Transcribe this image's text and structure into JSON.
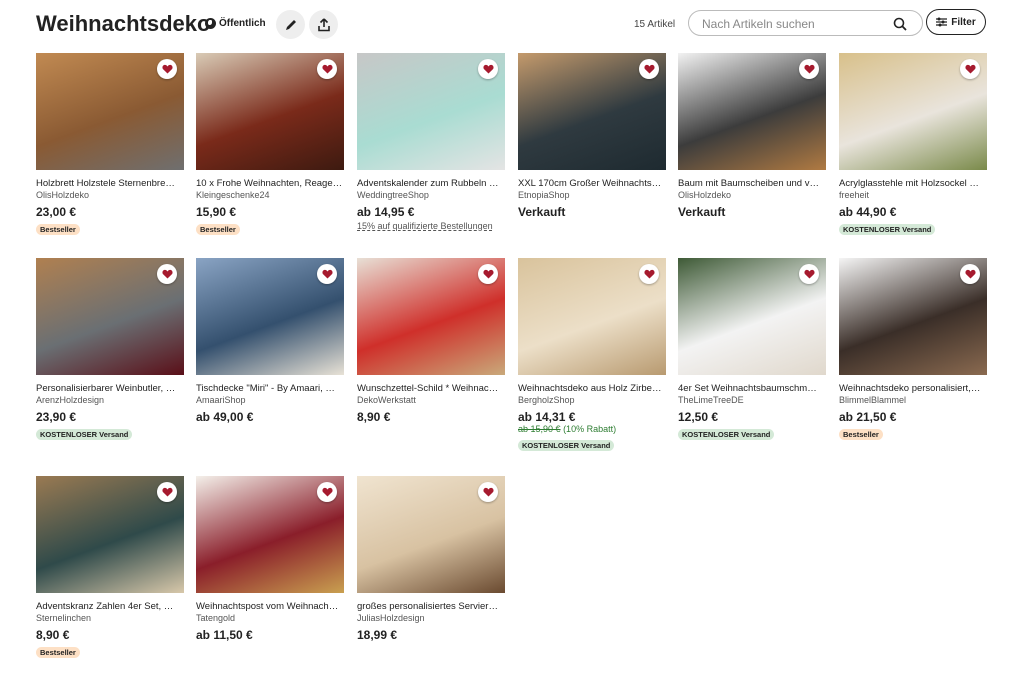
{
  "header": {
    "title": "Weihnachtsdeko",
    "visibility": "Öffentlich",
    "count": "15 Artikel",
    "search_placeholder": "Nach Artikeln suchen",
    "filter_label": "Filter",
    "icons": {
      "visibility": "globe-icon",
      "edit": "pencil-icon",
      "share": "share-icon",
      "search": "search-icon",
      "filter": "sliders-icon",
      "favorite": "heart-icon"
    }
  },
  "colors": {
    "accent": "#222222",
    "heart": "#a61a2e",
    "bestseller_badge": "#fde0c5",
    "shipping_badge": "#d4e9d7",
    "discount": "#2e7d32"
  },
  "items": [
    {
      "name": "Holzbrett Holzstele Sternenbre…",
      "shop": "OlisHolzdeko",
      "price": "23,00 €",
      "badge": "Bestseller",
      "badge_type": "best",
      "img": [
        "#8a5a33",
        "#c18a52",
        "#6f6f6f"
      ]
    },
    {
      "name": "10 x Frohe Weihnachten, Reage…",
      "shop": "Kleingeschenke24",
      "price": "15,90 €",
      "badge": "Bestseller",
      "badge_type": "best",
      "img": [
        "#7a2a1a",
        "#d9cbb6",
        "#3d1a10"
      ]
    },
    {
      "name": "Adventskalender zum Rubbeln …",
      "shop": "WeddingtreeShop",
      "price": "ab 14,95 €",
      "promo": "15% auf qualifizierte Bestellungen",
      "img": [
        "#a9dcd2",
        "#c7c7c7",
        "#e4e4e4"
      ]
    },
    {
      "name": "XXL 170cm Großer Weihnachts…",
      "shop": "EtnopiaShop",
      "price": "Verkauft",
      "img": [
        "#2f3a40",
        "#c49a6c",
        "#1e2a30"
      ]
    },
    {
      "name": "Baum mit Baumscheiben und v…",
      "shop": "OlisHolzdeko",
      "price": "Verkauft",
      "img": [
        "#3c3c3c",
        "#f2f2f2",
        "#b07a42"
      ]
    },
    {
      "name": "Acrylglasstehle mit Holzsockel …",
      "shop": "freeheit",
      "price": "ab 44,90 €",
      "badge": "KOSTENLOSER Versand",
      "badge_type": "free",
      "img": [
        "#e9e4dc",
        "#d8c08a",
        "#7a8a4a"
      ]
    },
    {
      "name": "Personalisierbarer Weinbutler, …",
      "shop": "ArenzHolzdesign",
      "price": "23,90 €",
      "badge": "KOSTENLOSER Versand",
      "badge_type": "free",
      "img": [
        "#6a6f73",
        "#b08050",
        "#5a0f18"
      ]
    },
    {
      "name": "Tischdecke \"Miri\" - By Amaari, …",
      "shop": "AmaariShop",
      "price": "ab 49,00 €",
      "img": [
        "#34506e",
        "#8aa4c4",
        "#e8e2d6"
      ]
    },
    {
      "name": "Wunschzettel-Schild * Weihnac…",
      "shop": "DekoWerkstatt",
      "price": "8,90 €",
      "img": [
        "#cf2f2a",
        "#e8e0d6",
        "#c9a97a"
      ]
    },
    {
      "name": "Weihnachtsdeko aus Holz Zirbe…",
      "shop": "BergholzShop",
      "price": "ab 14,31 €",
      "old_price": "ab 15,90 €",
      "discount": "(10% Rabatt)",
      "badge": "KOSTENLOSER Versand",
      "badge_type": "free",
      "img": [
        "#ecdfc8",
        "#d9c39c",
        "#b89a70"
      ]
    },
    {
      "name": "4er Set Weihnachtsbaumschm…",
      "shop": "TheLimeTreeDE",
      "price": "12,50 €",
      "badge": "KOSTENLOSER Versand",
      "badge_type": "free",
      "img": [
        "#f3f3f3",
        "#3e5a36",
        "#e0d8cc"
      ]
    },
    {
      "name": "Weihnachtsdeko personalisiert,…",
      "shop": "BlimmelBlammel",
      "price": "ab 21,50 €",
      "badge": "Bestseller",
      "badge_type": "best",
      "img": [
        "#3a2e28",
        "#f5f5f5",
        "#8a6a50"
      ]
    },
    {
      "name": "Adventskranz Zahlen 4er Set, …",
      "shop": "Sternelinchen",
      "price": "8,90 €",
      "badge": "Bestseller",
      "badge_type": "best",
      "img": [
        "#2f4a4a",
        "#9a7a52",
        "#d8c8aa"
      ]
    },
    {
      "name": "Weihnachtspost vom Weihnach…",
      "shop": "Tatengold",
      "price": "ab 11,50 €",
      "img": [
        "#8a1e2a",
        "#f4f0ea",
        "#c9a050"
      ]
    },
    {
      "name": "großes personalisiertes Servier…",
      "shop": "JuliasHolzdesign",
      "price": "18,99 €",
      "img": [
        "#d8c2a2",
        "#f0e4d0",
        "#6a4a30"
      ]
    }
  ]
}
